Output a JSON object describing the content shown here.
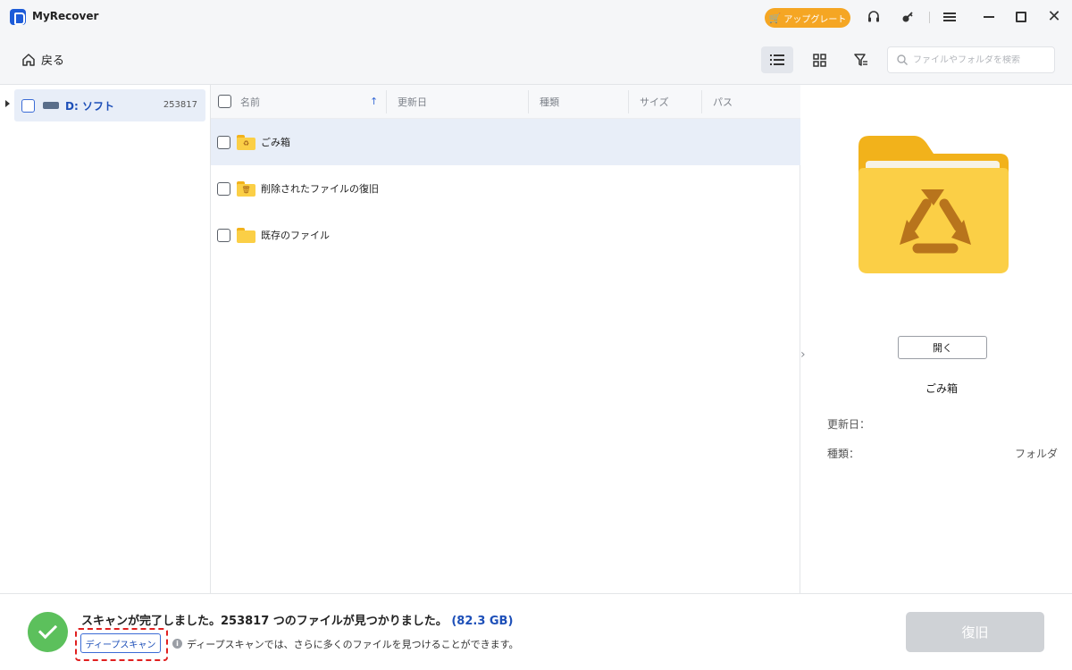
{
  "app": {
    "title": "MyRecover"
  },
  "titlebar": {
    "upgrade_label": "アップグレート",
    "icons": [
      "headset-icon",
      "key-icon",
      "menu-icon",
      "minimize-icon",
      "maximize-icon",
      "close-icon"
    ]
  },
  "toolbar": {
    "back_label": "戻る",
    "search_placeholder": "ファイルやフォルダを検索",
    "active_view": "list"
  },
  "tree": {
    "drive_label": "D: ソフト",
    "drive_count": "253817"
  },
  "columns": [
    "名前",
    "更新日",
    "種類",
    "サイズ",
    "パス"
  ],
  "rows": [
    {
      "label": "ごみ箱",
      "icon": "recycle-folder-icon"
    },
    {
      "label": "削除されたファイルの復旧",
      "icon": "trash-folder-icon"
    },
    {
      "label": "既存のファイル",
      "icon": "folder-icon"
    }
  ],
  "preview": {
    "open_label": "開く",
    "name": "ごみ箱",
    "modified_label": "更新日：",
    "modified_value": "",
    "type_label": "種類：",
    "type_value": "フォルダ"
  },
  "status": {
    "message": "スキャンが完了しました。253817 つのファイルが見つかりました。",
    "size": "(82.3 GB)",
    "deep_scan_label": "ディープスキャン",
    "deep_scan_hint": "ディープスキャンでは、さらに多くのファイルを見つけることができます。",
    "recover_label": "復旧"
  },
  "colors": {
    "accent": "#1d5bd8",
    "upgrade": "#f5a623",
    "success": "#5cc05c",
    "highlight": "#e02020",
    "selected_row": "#e8eef8",
    "folder": "#fbcf46"
  }
}
